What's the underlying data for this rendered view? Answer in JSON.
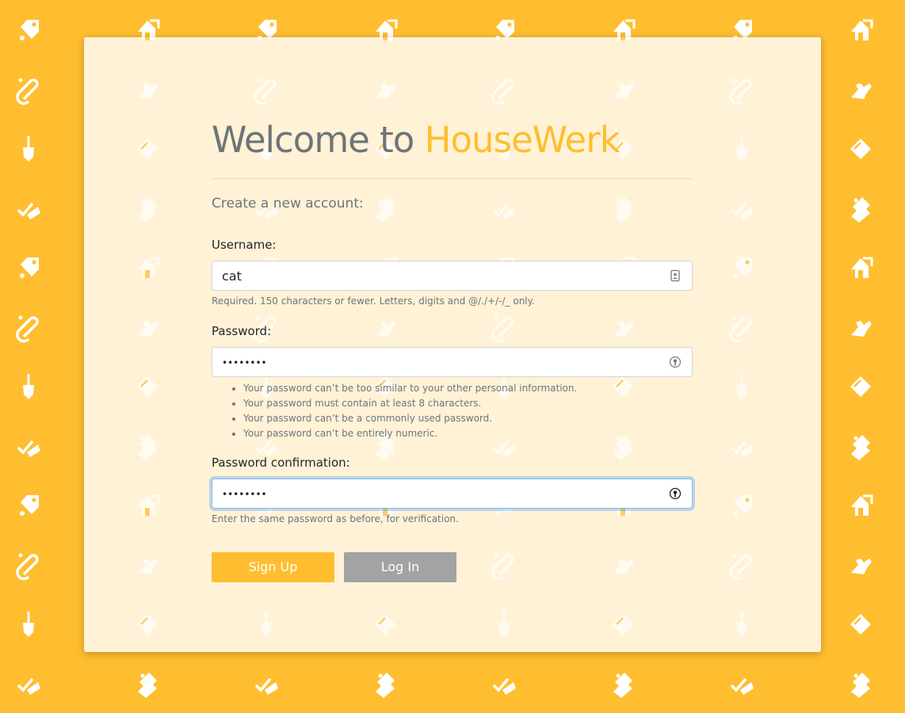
{
  "header": {
    "title_prefix": "Welcome to ",
    "title_brand": "HouseWerk"
  },
  "form": {
    "subtitle": "Create a new account:",
    "username": {
      "label": "Username:",
      "value": "cat",
      "help": "Required. 150 characters or fewer. Letters, digits and @/./+/-/_ only.",
      "icon": "contact-card-icon"
    },
    "password": {
      "label": "Password:",
      "value": "••••••••",
      "icon": "password-key-icon",
      "help_items": [
        "Your password can’t be too similar to your other personal information.",
        "Your password must contain at least 8 characters.",
        "Your password can’t be a commonly used password.",
        "Your password can’t be entirely numeric."
      ]
    },
    "password_confirmation": {
      "label": "Password confirmation:",
      "value": "••••••••",
      "icon": "password-key-icon",
      "help": "Enter the same password as before, for verification."
    }
  },
  "buttons": {
    "signup": "Sign Up",
    "login": "Log In"
  },
  "colors": {
    "background": "#FFBE30",
    "card": "#FFF2D6",
    "brand": "#FFBE30",
    "title_gray": "#6E7478",
    "login_button": "#A3A3A3"
  },
  "background_pattern_icons": [
    "price-tag-icon",
    "paper-clip-icon",
    "broom-icon",
    "checklist-icon",
    "house-arrow-icon",
    "rubber-glove-icon",
    "sponge-icon",
    "spray-bottle-icon"
  ]
}
